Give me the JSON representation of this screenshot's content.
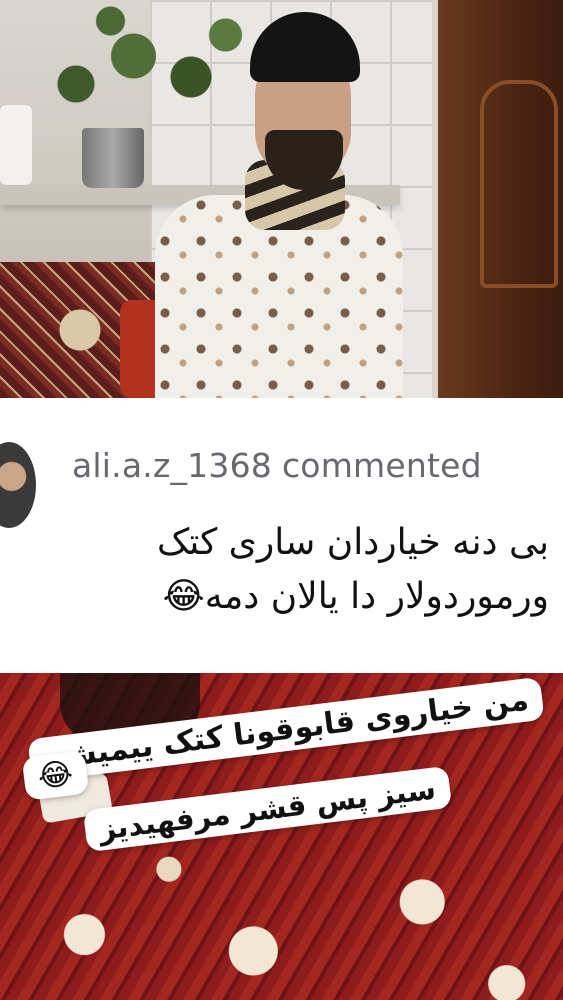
{
  "comment": {
    "username": "ali.a.z_1368",
    "action": "commented",
    "text": "بی دنه خیاردان ساری کتک\nورموردولار دا یالان  دمه😂"
  },
  "caption": {
    "line1": "من خیاروی قابوقونا کتک ییمیشم",
    "line2": "😂",
    "line3": "سیز پس  قشر مرفهیدیز"
  }
}
